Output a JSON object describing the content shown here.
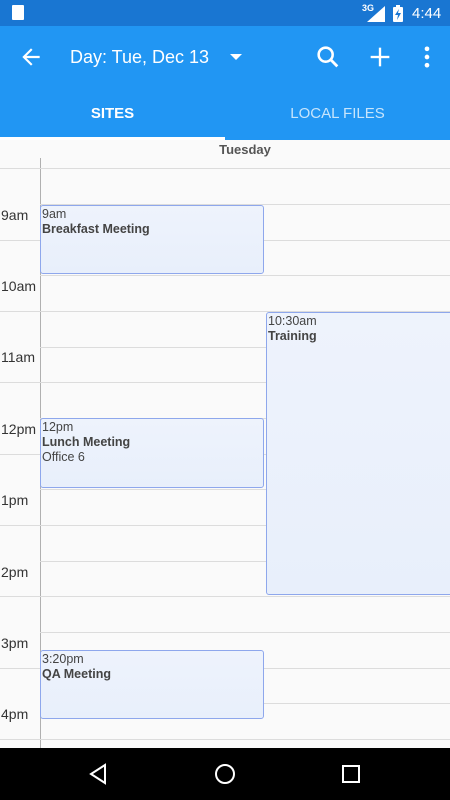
{
  "status_bar": {
    "network": "3G",
    "time": "4:44"
  },
  "toolbar": {
    "title": "Day: Tue, Dec 13"
  },
  "tabs": [
    {
      "label": "SITES"
    },
    {
      "label": "LOCAL FILES"
    }
  ],
  "calendar": {
    "day_name": "Tuesday",
    "hours": [
      "9am",
      "10am",
      "11am",
      "12pm",
      "1pm",
      "2pm",
      "3pm",
      "4pm"
    ],
    "events": [
      {
        "time": "9am",
        "title": "Breakfast Meeting",
        "location": ""
      },
      {
        "time": "10:30am",
        "title": "Training",
        "location": ""
      },
      {
        "time": "12pm",
        "title": "Lunch Meeting",
        "location": "Office 6"
      },
      {
        "time": "3:20pm",
        "title": "QA Meeting",
        "location": ""
      }
    ]
  },
  "colors": {
    "primary": "#2196f3",
    "status_bar": "#1976d2",
    "event_border": "#8ea7ec",
    "event_fill": "#eef3fc"
  }
}
